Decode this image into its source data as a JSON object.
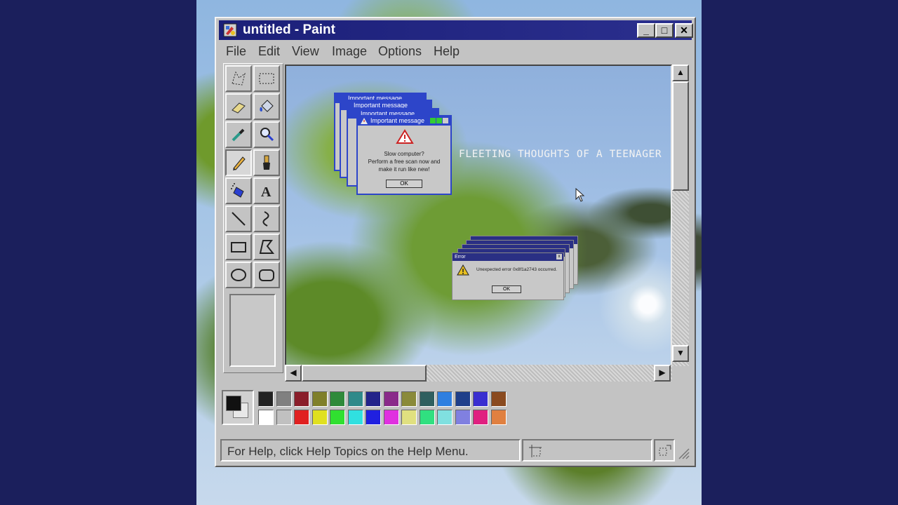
{
  "window": {
    "title": "untitled - Paint",
    "controls": {
      "minimize": "_",
      "maximize": "□",
      "close": "✕"
    }
  },
  "menu": {
    "items": [
      {
        "label": "File"
      },
      {
        "label": "Edit"
      },
      {
        "label": "View"
      },
      {
        "label": "Image"
      },
      {
        "label": "Options"
      },
      {
        "label": "Help"
      }
    ]
  },
  "tools": [
    "free-select-icon",
    "rect-select-icon",
    "eraser-icon",
    "fill-icon",
    "color-picker-icon",
    "magnifier-icon",
    "pencil-icon",
    "brush-icon",
    "airbrush-icon",
    "text-icon",
    "line-icon",
    "curve-icon",
    "rectangle-icon",
    "polygon-icon",
    "ellipse-icon",
    "rounded-rect-icon"
  ],
  "active_tool": "pencil-icon",
  "canvas": {
    "overlay_title": "FLEETING THOUGHTS OF A TEENAGER",
    "popup": {
      "title": "Important message",
      "line1": "Slow computer?",
      "line2": "Perform a free scan now and",
      "line3": "make it run like new!",
      "ok": "OK"
    },
    "error": {
      "title": "Error",
      "message": "Unexpected error 0x8f1a2743 occurred.",
      "ok": "OK"
    }
  },
  "palette": {
    "top": [
      "#222222",
      "#808080",
      "#8a1e2a",
      "#7f7f2a",
      "#2f8a3a",
      "#2f8a8a",
      "#23238a",
      "#8a2a8a",
      "#8a8a3a",
      "#2f5f5f",
      "#2f7fe0",
      "#1f3f8a",
      "#3a2fd0",
      "#8a4a1f"
    ],
    "bottom": [
      "#ffffff",
      "#c0c0c0",
      "#e02020",
      "#e0e020",
      "#30e030",
      "#30e0e0",
      "#2020e0",
      "#e030e0",
      "#e0e080",
      "#30e080",
      "#80e0e0",
      "#8080e0",
      "#e02080",
      "#e08040"
    ],
    "foreground": "#111111",
    "background": "#e8e8e8"
  },
  "status": {
    "text": "For Help, click Help Topics on the Help Menu."
  }
}
